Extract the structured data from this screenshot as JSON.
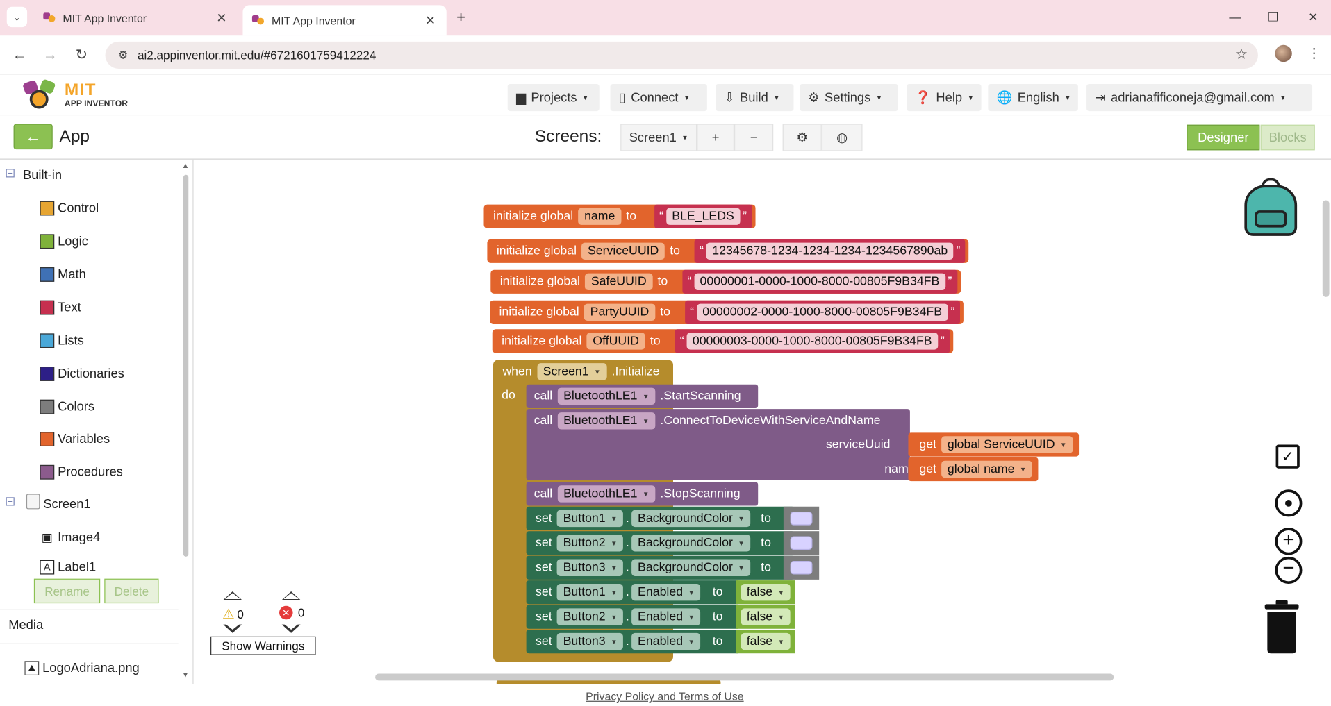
{
  "browser": {
    "tabs": [
      {
        "title": "MIT App Inventor"
      },
      {
        "title": "MIT App Inventor"
      }
    ],
    "url": "ai2.appinventor.mit.edu/#6721601759412224"
  },
  "header": {
    "logo_mit": "MIT",
    "logo_sub": "APP INVENTOR",
    "menus": [
      {
        "label": "Projects"
      },
      {
        "label": "Connect"
      },
      {
        "label": "Build"
      },
      {
        "label": "Settings"
      },
      {
        "label": "Help"
      },
      {
        "label": "English"
      },
      {
        "label": "adrianafificoneja@gmail.com"
      }
    ]
  },
  "subbar": {
    "project_name": "App",
    "screens_label": "Screens:",
    "screen_selected": "Screen1",
    "add_screen": "+",
    "remove_screen": "−",
    "designer": "Designer",
    "blocks": "Blocks"
  },
  "palette": {
    "builtin_label": "Built-in",
    "categories": [
      {
        "label": "Control",
        "color": "#e6a532"
      },
      {
        "label": "Logic",
        "color": "#7fb23a"
      },
      {
        "label": "Math",
        "color": "#3f71b5"
      },
      {
        "label": "Text",
        "color": "#c6304f"
      },
      {
        "label": "Lists",
        "color": "#4aa8d8"
      },
      {
        "label": "Dictionaries",
        "color": "#2d1f87"
      },
      {
        "label": "Colors",
        "color": "#7d7d7d"
      },
      {
        "label": "Variables",
        "color": "#e2642c"
      },
      {
        "label": "Procedures",
        "color": "#8c5b8d"
      }
    ],
    "screen_label": "Screen1",
    "components": [
      {
        "label": "Image4"
      },
      {
        "label": "Label1"
      }
    ],
    "rename": "Rename",
    "delete": "Delete",
    "media_label": "Media",
    "media_files": [
      {
        "label": "LogoAdriana.png"
      }
    ]
  },
  "blocks": {
    "globals": [
      {
        "kw": "initialize global",
        "name": "name",
        "to": "to",
        "value": "BLE_LEDS"
      },
      {
        "kw": "initialize global",
        "name": "ServiceUUID",
        "to": "to",
        "value": "12345678-1234-1234-1234-1234567890ab"
      },
      {
        "kw": "initialize global",
        "name": "SafeUUID",
        "to": "to",
        "value": "00000001-0000-1000-8000-00805F9B34FB"
      },
      {
        "kw": "initialize global",
        "name": "PartyUUID",
        "to": "to",
        "value": "00000002-0000-1000-8000-00805F9B34FB"
      },
      {
        "kw": "initialize global",
        "name": "OffUUID",
        "to": "to",
        "value": "00000003-0000-1000-8000-00805F9B34FB"
      }
    ],
    "event": {
      "when": "when",
      "component": "Screen1",
      "event": ".Initialize",
      "do": "do"
    },
    "calls": [
      {
        "call": "call",
        "component": "BluetoothLE1",
        "method": ".StartScanning"
      },
      {
        "call": "call",
        "component": "BluetoothLE1",
        "method": ".ConnectToDeviceWithServiceAndName",
        "args": [
          {
            "label": "serviceUuid",
            "get": "get",
            "var": "global ServiceUUID"
          },
          {
            "label": "name",
            "get": "get",
            "var": "global name"
          }
        ]
      },
      {
        "call": "call",
        "component": "BluetoothLE1",
        "method": ".StopScanning"
      }
    ],
    "sets": [
      {
        "set": "set",
        "component": "Button1",
        "prop": "BackgroundColor",
        "to": "to"
      },
      {
        "set": "set",
        "component": "Button2",
        "prop": "BackgroundColor",
        "to": "to"
      },
      {
        "set": "set",
        "component": "Button3",
        "prop": "BackgroundColor",
        "to": "to"
      },
      {
        "set": "set",
        "component": "Button1",
        "prop": "Enabled",
        "to": "to",
        "value": "false"
      },
      {
        "set": "set",
        "component": "Button2",
        "prop": "Enabled",
        "to": "to",
        "value": "false"
      },
      {
        "set": "set",
        "component": "Button3",
        "prop": "Enabled",
        "to": "to",
        "value": "false"
      }
    ],
    "dot": "."
  },
  "warnings": {
    "warning_count": "0",
    "error_count": "0",
    "show_warnings": "Show Warnings"
  },
  "footer": {
    "link": "Privacy Policy and Terms of Use"
  },
  "colors": {
    "variables": "#e2642c",
    "text": "#c6304f",
    "control": "#b58c2c",
    "bluetooth": "#7f5b88",
    "component_set": "#2d6e4e",
    "accent_green": "#8cc152"
  }
}
